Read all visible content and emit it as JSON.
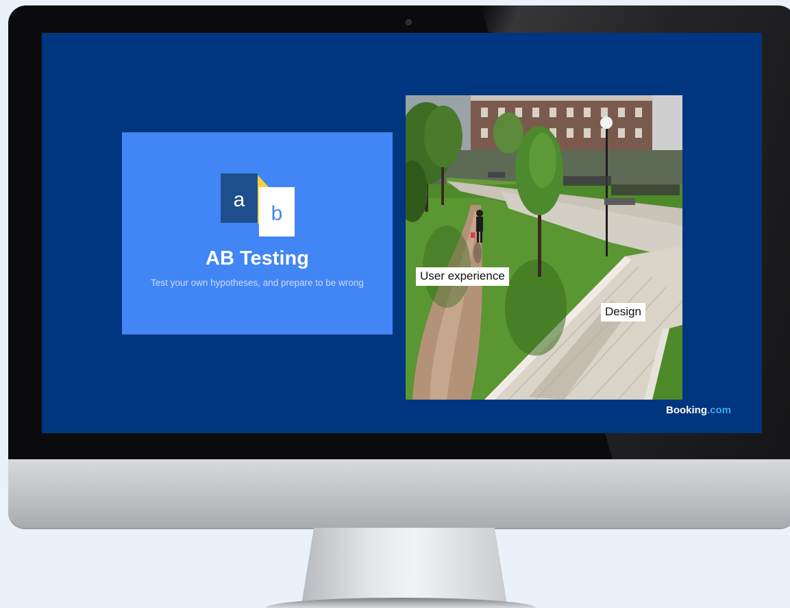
{
  "slide": {
    "ab_logo": {
      "letter_a": "a",
      "letter_b": "b"
    },
    "title": "AB Testing",
    "subtitle": "Test your own hypotheses, and prepare to be wrong",
    "photo_labels": {
      "user_experience": "User experience",
      "design": "Design"
    },
    "brand": {
      "name": "Booking",
      "suffix": ".com"
    }
  },
  "colors": {
    "slide_background": "#003580",
    "card_background": "#4286f5",
    "logo_dark": "#1e4e8c",
    "logo_yellow": "#f4d03f",
    "brand_dotcom": "#40a5e8"
  },
  "icons": [
    "ab-logo-icon",
    "webcam-icon"
  ]
}
